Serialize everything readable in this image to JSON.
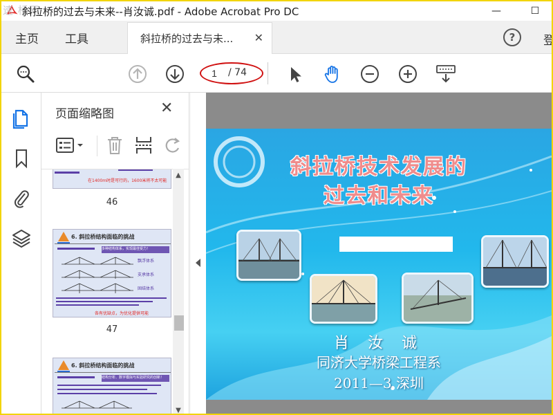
{
  "window": {
    "title": "斜拉桥的过去与未来--肖汝诚.pdf - Adobe Acrobat Pro DC",
    "watermark": "速 桥网",
    "minimize_label": "—",
    "maximize_label": "☐"
  },
  "menubar": {
    "home_label": "主页",
    "tools_label": "工具",
    "doc_tab_label": "斜拉桥的过去与未...",
    "doc_tab_close": "✕",
    "help_label": "?",
    "cut_label": "登"
  },
  "toolbar": {
    "current_page": "1",
    "total_pages": "/ 74"
  },
  "thumb_panel": {
    "title": "页面缩略图",
    "close_label": "✕",
    "pages": [
      {
        "number": "46",
        "caption": "在1400m时是可行的，1600米将不太可能"
      },
      {
        "number": "47",
        "heading": "6. 斜拉桥结构面临的挑战",
        "subhead": "多种结构体系，实现最佳受力！",
        "labels": [
          "飘浮体系",
          "支承体系",
          "固结体系"
        ],
        "footer": "各有优缺点，为优化提供可能"
      },
      {
        "number": "",
        "heading": "6. 斜拉桥结构面临的挑战",
        "subhead": "结构分析、数字模拟与实验研究的创新！"
      }
    ]
  },
  "slide": {
    "title_line1": "斜拉桥技术发展的",
    "title_line2": "过去和未来",
    "author": "肖 汝 诚",
    "affiliation": "同济大学桥梁工程系",
    "date": "2011—3  深圳"
  },
  "colors": {
    "accent_red": "#d01010",
    "title_pink": "#ef8c8c",
    "slide_blue": "#22b8ec",
    "acrobat_red": "#e12825",
    "hand_tool_blue": "#1473e6"
  }
}
